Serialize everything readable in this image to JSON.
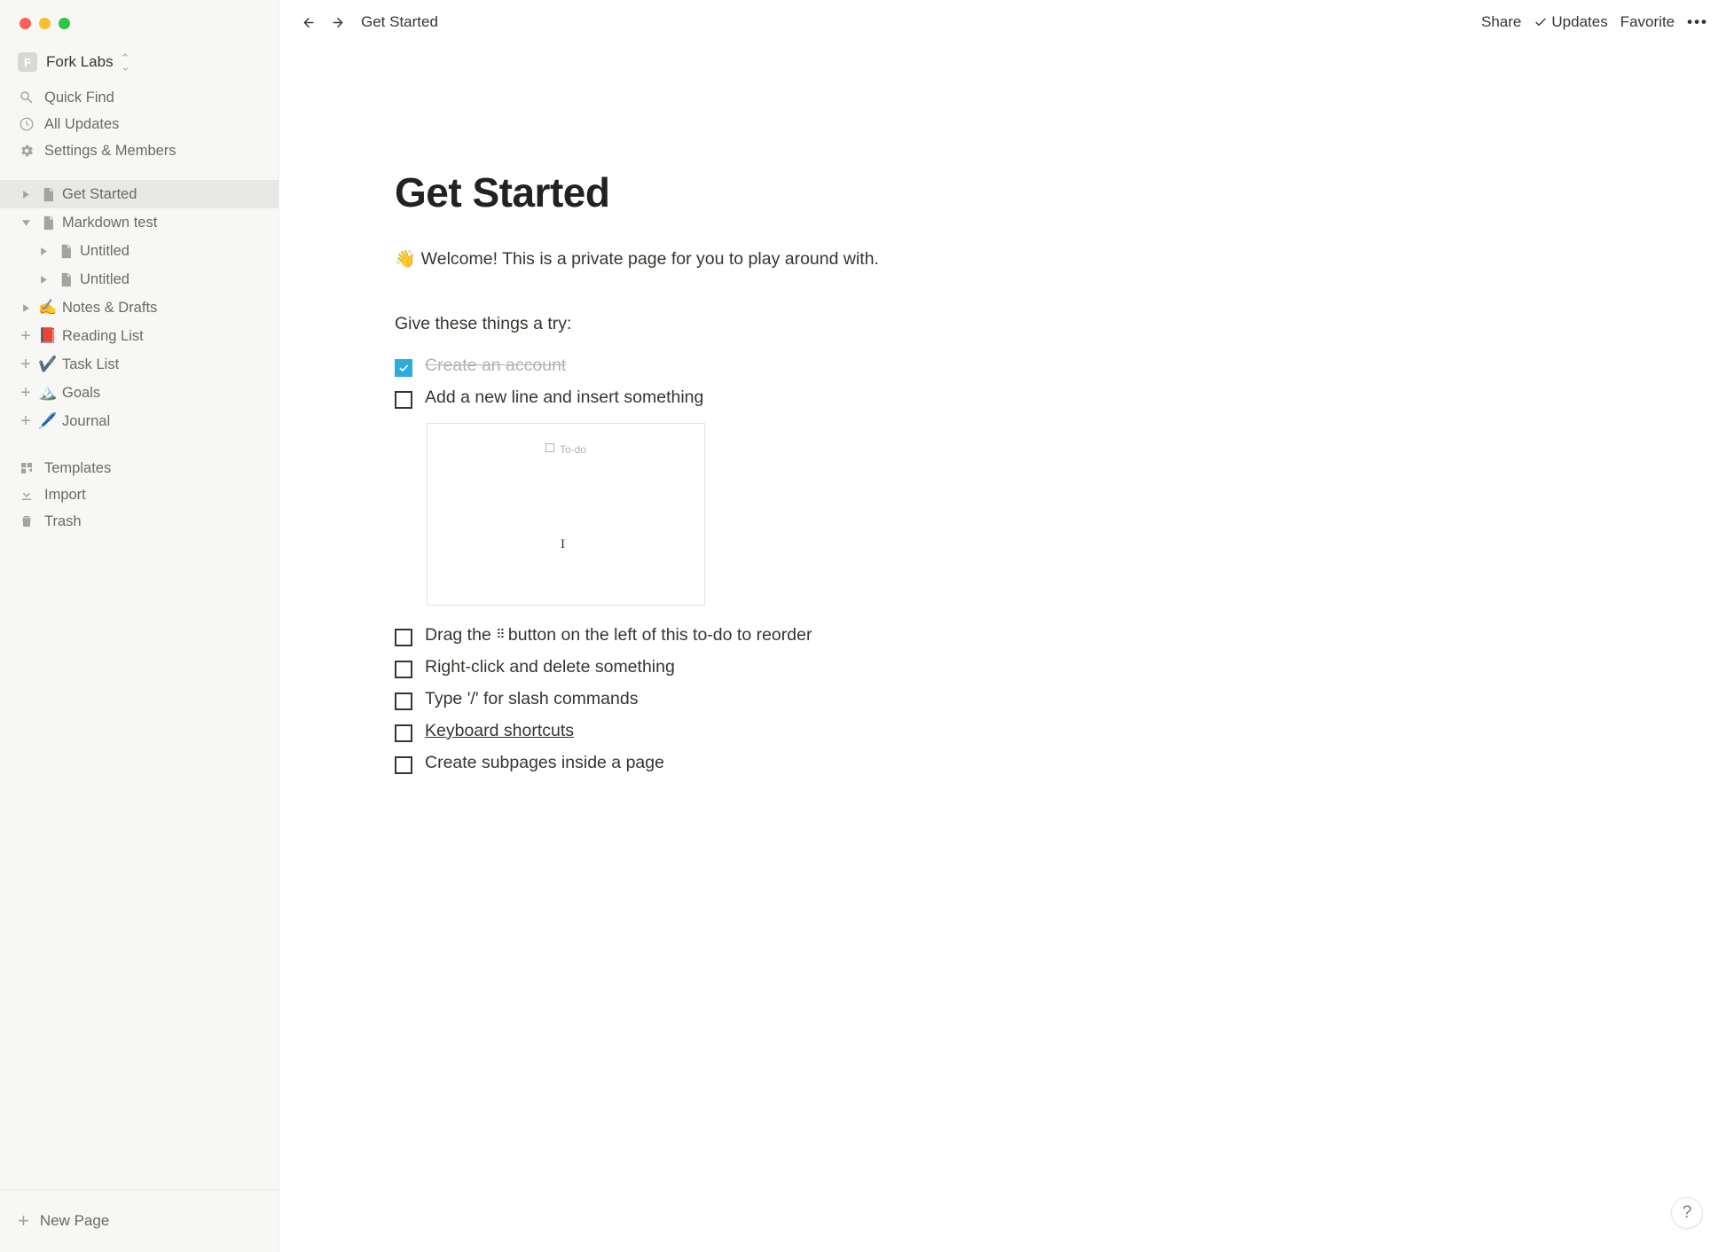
{
  "workspace": {
    "initial": "F",
    "name": "Fork Labs"
  },
  "sidebar_top": {
    "quick_find": "Quick Find",
    "all_updates": "All Updates",
    "settings": "Settings & Members"
  },
  "page_tree": [
    {
      "label": "Get Started",
      "toggle": "caret-right",
      "icon": "page",
      "selected": true,
      "indent": 0
    },
    {
      "label": "Markdown test",
      "toggle": "caret-down",
      "icon": "page",
      "selected": false,
      "indent": 0
    },
    {
      "label": "Untitled",
      "toggle": "caret-right",
      "icon": "page",
      "selected": false,
      "indent": 1
    },
    {
      "label": "Untitled",
      "toggle": "caret-right",
      "icon": "page",
      "selected": false,
      "indent": 1
    },
    {
      "label": "Notes & Drafts",
      "toggle": "caret-right",
      "icon": "emoji",
      "emoji": "✍️",
      "selected": false,
      "indent": 0
    },
    {
      "label": "Reading List",
      "toggle": "plus",
      "icon": "emoji",
      "emoji": "📕",
      "selected": false,
      "indent": 0
    },
    {
      "label": "Task List",
      "toggle": "plus",
      "icon": "emoji",
      "emoji": "✔️",
      "selected": false,
      "indent": 0
    },
    {
      "label": "Goals",
      "toggle": "plus",
      "icon": "emoji",
      "emoji": "🏔️",
      "selected": false,
      "indent": 0
    },
    {
      "label": "Journal",
      "toggle": "plus",
      "icon": "emoji",
      "emoji": "🖊️",
      "selected": false,
      "indent": 0
    }
  ],
  "sidebar_footer": {
    "templates": "Templates",
    "import": "Import",
    "trash": "Trash"
  },
  "new_page_label": "New Page",
  "topbar": {
    "breadcrumb": "Get Started",
    "share": "Share",
    "updates": "Updates",
    "favorite": "Favorite"
  },
  "page": {
    "title": "Get Started",
    "intro_emoji": "👋",
    "intro_text": "Welcome! This is a private page for you to play around with.",
    "subhead": "Give these things a try:",
    "todos": [
      {
        "text": "Create an account",
        "checked": true
      },
      {
        "text": "Add a new line and insert something",
        "checked": false
      },
      {
        "text": "Drag the ⠿ button on the left of this to-do to reorder",
        "checked": false,
        "has_drag": true
      },
      {
        "text": "Right-click and delete something",
        "checked": false
      },
      {
        "text": "Type '/' for slash commands",
        "checked": false
      },
      {
        "text": "Keyboard shortcuts",
        "checked": false,
        "link": true
      },
      {
        "text": "Create subpages inside a page",
        "checked": false
      }
    ],
    "embed_placeholder": "To-do"
  },
  "help_label": "?"
}
